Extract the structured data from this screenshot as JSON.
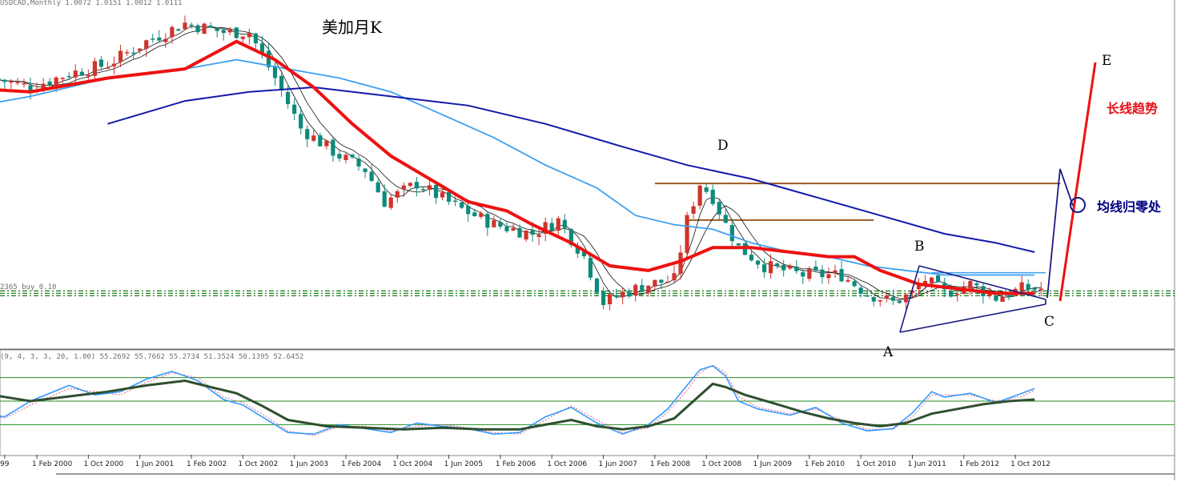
{
  "window": {
    "symbol_header": "USDCAD,Monthly  1.0072 1.0151 1.0012 1.0111",
    "buy_level_label": "2365 buy 0.10",
    "oscillator_header": "(9, 4, 3, 3, 20, 1.00) 55.2692 55.7662 55.2734 51.3524 50.1395 52.6452"
  },
  "annotations": {
    "title": "美加月K",
    "point_a": "A",
    "point_b": "B",
    "point_c": "C",
    "point_d": "D",
    "point_e": "E",
    "long_trend": "长线趋势",
    "ma_zero": "均线归零处"
  },
  "colors": {
    "bull_candle": "#d0342c",
    "bear_candle": "#0e8a7a",
    "ma_red": "#ee1111",
    "ma_light_blue": "#3ea0f0",
    "ma_dark_blue": "#121aa8",
    "ma_thin": "#111111",
    "resistance": "#9a5a22",
    "support_dashed": "#1a7a1a",
    "pattern_lines": "#1a1a80",
    "osc_fast": "#3399ff",
    "osc_signal": "#e06080",
    "osc_slow": "#2f4f2f",
    "osc_levels": "#228b22"
  },
  "chart_data": {
    "type": "candlestick",
    "x_ticks": [
      "99",
      "1 Feb 2000",
      "1 Oct 2000",
      "1 Jun 2001",
      "1 Feb 2002",
      "1 Oct 2002",
      "1 Jun 2003",
      "1 Feb 2004",
      "1 Oct 2004",
      "1 Jun 2005",
      "1 Feb 2006",
      "1 Oct 2006",
      "1 Jun 2007",
      "1 Feb 2008",
      "1 Oct 2008",
      "1 Jun 2009",
      "1 Feb 2010",
      "1 Oct 2010",
      "1 Jun 2011",
      "1 Feb 2012",
      "1 Oct 2012"
    ],
    "x_tick_months": [
      -4,
      1,
      9,
      17,
      25,
      33,
      41,
      49,
      57,
      65,
      73,
      81,
      89,
      97,
      105,
      113,
      121,
      129,
      137,
      145,
      153
    ],
    "month_origin": "2000-01",
    "ylim": [
      0.88,
      1.63
    ],
    "price_anchors": [
      [
        -12,
        1.48
      ],
      [
        -6,
        1.47
      ],
      [
        0,
        1.45
      ],
      [
        6,
        1.48
      ],
      [
        12,
        1.5
      ],
      [
        18,
        1.55
      ],
      [
        24,
        1.59
      ],
      [
        30,
        1.57
      ],
      [
        34,
        1.57
      ],
      [
        38,
        1.47
      ],
      [
        42,
        1.36
      ],
      [
        48,
        1.3
      ],
      [
        52,
        1.27
      ],
      [
        55,
        1.2
      ],
      [
        60,
        1.24
      ],
      [
        66,
        1.19
      ],
      [
        72,
        1.15
      ],
      [
        78,
        1.13
      ],
      [
        82,
        1.16
      ],
      [
        86,
        1.08
      ],
      [
        89,
        0.98
      ],
      [
        92,
        1.0
      ],
      [
        96,
        1.02
      ],
      [
        100,
        1.03
      ],
      [
        102,
        1.16
      ],
      [
        104,
        1.24
      ],
      [
        106,
        1.21
      ],
      [
        108,
        1.15
      ],
      [
        110,
        1.1
      ],
      [
        114,
        1.06
      ],
      [
        120,
        1.04
      ],
      [
        126,
        1.04
      ],
      [
        130,
        1.0
      ],
      [
        134,
        0.98
      ],
      [
        137,
        1.0
      ],
      [
        139,
        1.03
      ],
      [
        142,
        1.0
      ],
      [
        146,
        1.02
      ],
      [
        150,
        0.99
      ],
      [
        154,
        1.01
      ],
      [
        156,
        1.01
      ]
    ],
    "ma_red": [
      [
        -12,
        1.45
      ],
      [
        0,
        1.44
      ],
      [
        12,
        1.47
      ],
      [
        24,
        1.49
      ],
      [
        32,
        1.55
      ],
      [
        38,
        1.51
      ],
      [
        44,
        1.45
      ],
      [
        50,
        1.37
      ],
      [
        56,
        1.3
      ],
      [
        62,
        1.25
      ],
      [
        68,
        1.2
      ],
      [
        74,
        1.18
      ],
      [
        78,
        1.15
      ],
      [
        84,
        1.11
      ],
      [
        90,
        1.06
      ],
      [
        96,
        1.05
      ],
      [
        101,
        1.07
      ],
      [
        106,
        1.1
      ],
      [
        112,
        1.1
      ],
      [
        118,
        1.09
      ],
      [
        124,
        1.08
      ],
      [
        128,
        1.08
      ],
      [
        132,
        1.05
      ],
      [
        138,
        1.02
      ],
      [
        144,
        1.01
      ],
      [
        150,
        1.0
      ],
      [
        156,
        1.0
      ]
    ],
    "ma_light_blue": [
      [
        -12,
        1.4
      ],
      [
        0,
        1.43
      ],
      [
        12,
        1.47
      ],
      [
        24,
        1.49
      ],
      [
        32,
        1.51
      ],
      [
        40,
        1.49
      ],
      [
        48,
        1.47
      ],
      [
        56,
        1.44
      ],
      [
        64,
        1.39
      ],
      [
        72,
        1.34
      ],
      [
        80,
        1.28
      ],
      [
        88,
        1.23
      ],
      [
        94,
        1.17
      ],
      [
        100,
        1.15
      ],
      [
        106,
        1.14
      ],
      [
        112,
        1.11
      ],
      [
        118,
        1.09
      ],
      [
        124,
        1.08
      ],
      [
        130,
        1.06
      ],
      [
        136,
        1.05
      ],
      [
        142,
        1.04
      ],
      [
        150,
        1.04
      ],
      [
        156,
        1.04
      ]
    ],
    "ma_dark_blue": [
      [
        12,
        1.37
      ],
      [
        24,
        1.42
      ],
      [
        34,
        1.44
      ],
      [
        44,
        1.45
      ],
      [
        56,
        1.43
      ],
      [
        68,
        1.41
      ],
      [
        80,
        1.37
      ],
      [
        92,
        1.32
      ],
      [
        102,
        1.28
      ],
      [
        112,
        1.25
      ],
      [
        122,
        1.21
      ],
      [
        132,
        1.17
      ],
      [
        142,
        1.13
      ],
      [
        150,
        1.11
      ],
      [
        156,
        1.09
      ]
    ],
    "resistance_levels": [
      [
        97,
        160,
        1.24
      ],
      [
        102,
        131,
        1.16
      ]
    ],
    "support_level": 1.0,
    "osc_levels": [
      80,
      50,
      20
    ],
    "osc_fast": [
      [
        -12,
        60
      ],
      [
        -8,
        35
      ],
      [
        -4,
        30
      ],
      [
        0,
        50
      ],
      [
        6,
        70
      ],
      [
        10,
        58
      ],
      [
        14,
        62
      ],
      [
        18,
        78
      ],
      [
        22,
        88
      ],
      [
        26,
        76
      ],
      [
        30,
        52
      ],
      [
        33,
        45
      ],
      [
        36,
        30
      ],
      [
        40,
        10
      ],
      [
        44,
        8
      ],
      [
        48,
        20
      ],
      [
        52,
        15
      ],
      [
        56,
        10
      ],
      [
        60,
        22
      ],
      [
        64,
        18
      ],
      [
        68,
        15
      ],
      [
        72,
        8
      ],
      [
        76,
        10
      ],
      [
        80,
        30
      ],
      [
        84,
        42
      ],
      [
        88,
        22
      ],
      [
        92,
        8
      ],
      [
        96,
        20
      ],
      [
        99,
        40
      ],
      [
        102,
        70
      ],
      [
        104,
        90
      ],
      [
        106,
        95
      ],
      [
        108,
        82
      ],
      [
        110,
        50
      ],
      [
        113,
        40
      ],
      [
        118,
        32
      ],
      [
        122,
        42
      ],
      [
        126,
        22
      ],
      [
        130,
        12
      ],
      [
        134,
        15
      ],
      [
        137,
        35
      ],
      [
        140,
        62
      ],
      [
        142,
        55
      ],
      [
        146,
        60
      ],
      [
        150,
        48
      ],
      [
        154,
        60
      ],
      [
        156,
        66
      ]
    ],
    "osc_signal": [
      [
        -12,
        62
      ],
      [
        -8,
        38
      ],
      [
        -4,
        28
      ],
      [
        0,
        45
      ],
      [
        6,
        66
      ],
      [
        10,
        62
      ],
      [
        14,
        58
      ],
      [
        18,
        74
      ],
      [
        22,
        86
      ],
      [
        26,
        80
      ],
      [
        30,
        55
      ],
      [
        33,
        48
      ],
      [
        36,
        34
      ],
      [
        40,
        12
      ],
      [
        44,
        6
      ],
      [
        48,
        18
      ],
      [
        52,
        18
      ],
      [
        56,
        12
      ],
      [
        60,
        18
      ],
      [
        64,
        20
      ],
      [
        68,
        16
      ],
      [
        72,
        10
      ],
      [
        76,
        8
      ],
      [
        80,
        26
      ],
      [
        84,
        44
      ],
      [
        88,
        26
      ],
      [
        92,
        10
      ],
      [
        96,
        16
      ],
      [
        99,
        36
      ],
      [
        102,
        64
      ],
      [
        104,
        86
      ],
      [
        106,
        96
      ],
      [
        108,
        86
      ],
      [
        110,
        56
      ],
      [
        113,
        42
      ],
      [
        118,
        34
      ],
      [
        122,
        40
      ],
      [
        126,
        26
      ],
      [
        130,
        14
      ],
      [
        134,
        14
      ],
      [
        137,
        30
      ],
      [
        140,
        58
      ],
      [
        142,
        58
      ],
      [
        146,
        58
      ],
      [
        150,
        50
      ],
      [
        154,
        56
      ],
      [
        156,
        64
      ]
    ],
    "osc_slow": [
      [
        -12,
        70
      ],
      [
        -6,
        58
      ],
      [
        0,
        50
      ],
      [
        6,
        56
      ],
      [
        12,
        62
      ],
      [
        18,
        70
      ],
      [
        24,
        76
      ],
      [
        28,
        68
      ],
      [
        32,
        60
      ],
      [
        36,
        44
      ],
      [
        40,
        26
      ],
      [
        46,
        18
      ],
      [
        52,
        16
      ],
      [
        58,
        14
      ],
      [
        64,
        16
      ],
      [
        70,
        14
      ],
      [
        76,
        14
      ],
      [
        80,
        20
      ],
      [
        84,
        26
      ],
      [
        88,
        18
      ],
      [
        92,
        14
      ],
      [
        96,
        18
      ],
      [
        100,
        28
      ],
      [
        103,
        50
      ],
      [
        106,
        72
      ],
      [
        108,
        68
      ],
      [
        111,
        58
      ],
      [
        116,
        46
      ],
      [
        120,
        36
      ],
      [
        124,
        28
      ],
      [
        128,
        22
      ],
      [
        132,
        18
      ],
      [
        136,
        22
      ],
      [
        140,
        34
      ],
      [
        144,
        40
      ],
      [
        148,
        46
      ],
      [
        152,
        50
      ],
      [
        156,
        52
      ]
    ]
  }
}
